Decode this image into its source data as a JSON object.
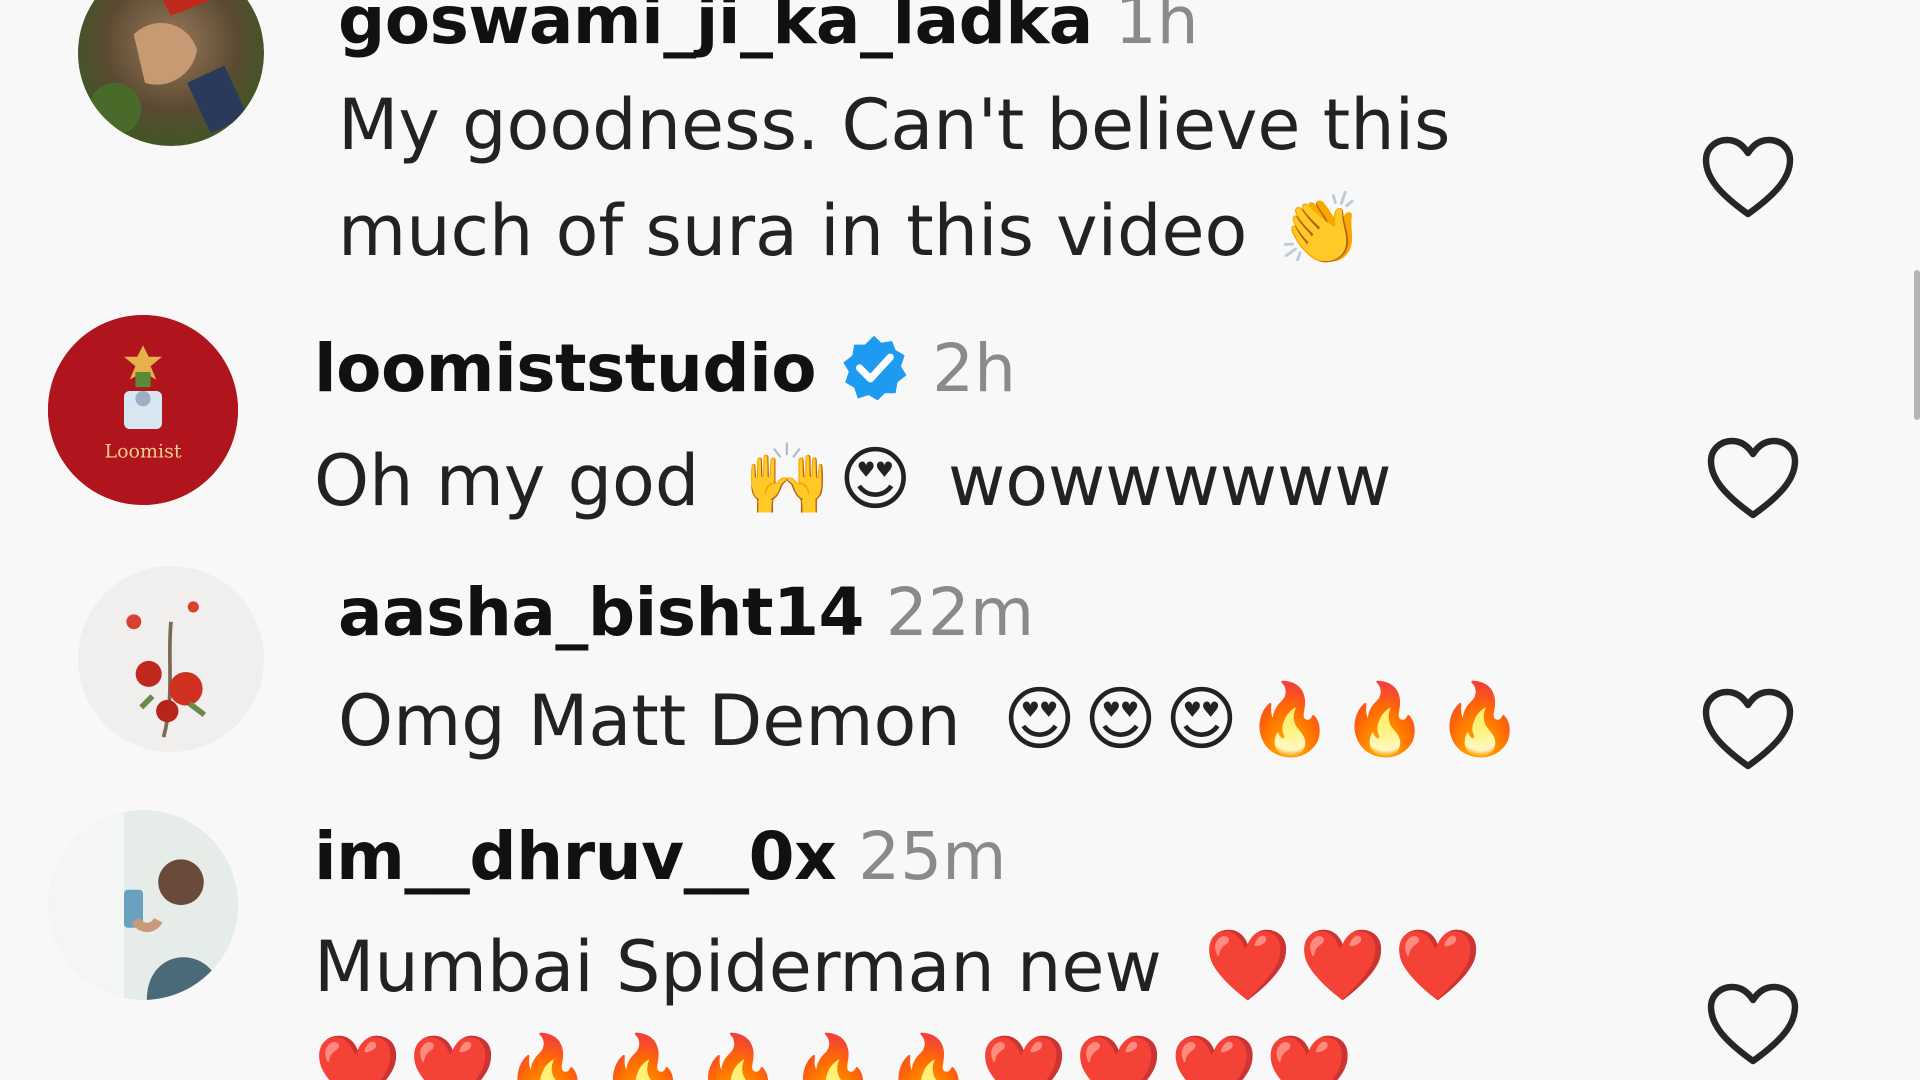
{
  "comments": [
    {
      "username": "goswami_ji_ka_ladka",
      "time": "1h",
      "lines": [
        "My goodness. Can't believe this",
        "much of sura in this video"
      ],
      "emoji": [
        "👏"
      ],
      "verified": false
    },
    {
      "username": "loomiststudio",
      "time": "2h",
      "lines": [
        "Oh my god"
      ],
      "emoji": [
        "🙌",
        "😍"
      ],
      "suffix": "wowwwwww",
      "verified": true,
      "avatar_text": "Loomist"
    },
    {
      "username": "aasha_bisht14",
      "time": "22m",
      "lines": [
        "Omg Matt Demon"
      ],
      "emoji": [
        "😍",
        "😍",
        "😍",
        "🔥",
        "🔥",
        "🔥"
      ],
      "verified": false
    },
    {
      "username": "im__dhruv__0x",
      "time": "25m",
      "lines": [
        "Mumbai Spiderman new"
      ],
      "emoji": [
        "❤️",
        "❤️",
        "❤️"
      ],
      "emoji_line2": [
        "❤️",
        "❤️",
        "🔥",
        "🔥",
        "🔥",
        "🔥",
        "🔥",
        "❤️",
        "❤️",
        "❤️",
        "❤️"
      ],
      "verified": false
    }
  ],
  "icons": {
    "like": "heart-outline-icon",
    "verified": "verified-badge-icon"
  },
  "colors": {
    "background": "#f8f8f8",
    "username": "#111111",
    "timestamp": "#8a8a8a",
    "verified": "#1d9bf0",
    "heart_outline": "#262626"
  }
}
